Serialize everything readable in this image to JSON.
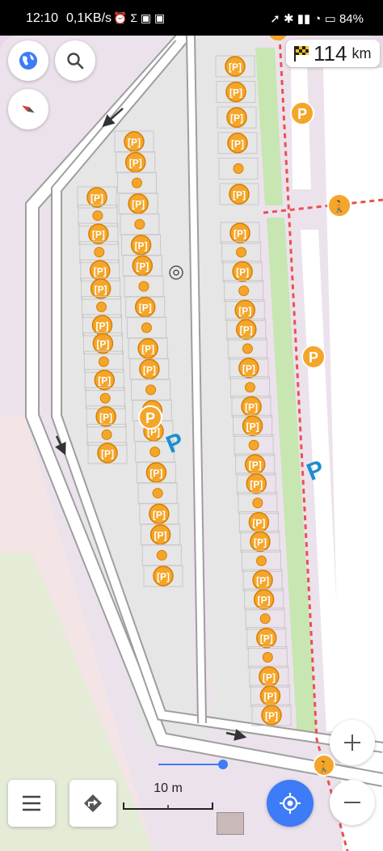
{
  "status_bar": {
    "time": "12:10",
    "network_speed": "0,1KB/s",
    "battery": "84"
  },
  "navigation": {
    "distance_value": "114",
    "distance_unit": "km"
  },
  "map": {
    "scale_label": "10 m"
  },
  "colors": {
    "parking_icon": "#f4a62a",
    "parking_icon_border": "#d97d00",
    "route_line": "#e8524f",
    "accent_blue": "#3d7bf7",
    "green_strip": "#c7e6b1",
    "road": "#ffffff",
    "parking_area": "#e6e6e6"
  },
  "icons": {
    "globe": "globe-icon",
    "search": "search-icon",
    "compass": "compass-icon",
    "flag": "checkered-flag-icon",
    "menu": "menu-icon",
    "directions": "directions-icon",
    "my_location": "my-location-icon",
    "zoom_in": "plus-icon",
    "zoom_out": "minus-icon"
  }
}
